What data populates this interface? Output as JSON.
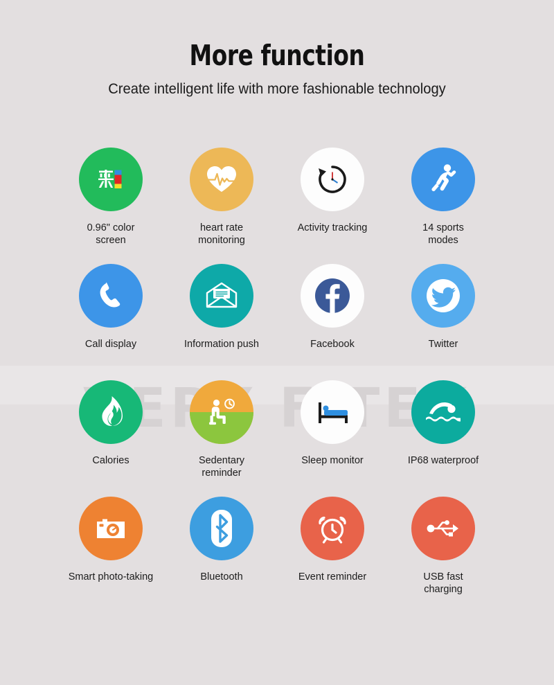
{
  "header": {
    "title": "More function",
    "subtitle": "Create intelligent life with more fashionable technology"
  },
  "watermark": {
    "text": "VERY FiTEK"
  },
  "colors": {
    "background": "#e3dfe0",
    "green": "#22bb5b",
    "gold": "#edb857",
    "white": "#fdfdfd",
    "blue": "#3d95e8",
    "teal_info": "#0ea9a8",
    "fb_blue": "#3b5998",
    "twitter_blue": "#55acee",
    "emerald": "#17b877",
    "orange_top": "#f0a93c",
    "green_bottom": "#8cc63e",
    "teal_water": "#0cab9e",
    "orange": "#ee8232",
    "bt_blue": "#3d9ee0",
    "red_orange": "#e8634a"
  },
  "features": [
    {
      "id": "color-screen",
      "label": "0.96\" color\nscreen",
      "icon": "color-screen-icon",
      "circle": "#22bb5b"
    },
    {
      "id": "heart-rate",
      "label": "heart rate\nmonitoring",
      "icon": "heart-rate-icon",
      "circle": "#edb857"
    },
    {
      "id": "activity-tracking",
      "label": "Activity tracking",
      "icon": "activity-clock-icon",
      "circle": "#fdfdfd"
    },
    {
      "id": "sports-modes",
      "label": "14 sports\nmodes",
      "icon": "running-person-icon",
      "circle": "#3d95e8"
    },
    {
      "id": "call-display",
      "label": "Call display",
      "icon": "phone-icon",
      "circle": "#3d95e8"
    },
    {
      "id": "information-push",
      "label": "Information push",
      "icon": "envelope-message-icon",
      "circle": "#0ea9a8"
    },
    {
      "id": "facebook",
      "label": "Facebook",
      "icon": "facebook-icon",
      "circle": "#fdfdfd"
    },
    {
      "id": "twitter",
      "label": "Twitter",
      "icon": "twitter-bird-icon",
      "circle": "#55acee"
    },
    {
      "id": "calories",
      "label": "Calories",
      "icon": "flame-icon",
      "circle": "#17b877"
    },
    {
      "id": "sedentary",
      "label": "Sedentary\nreminder",
      "icon": "sitting-person-clock-icon",
      "circle": "#f0a93c"
    },
    {
      "id": "sleep-monitor",
      "label": "Sleep monitor",
      "icon": "bed-icon",
      "circle": "#fdfdfd"
    },
    {
      "id": "ip68-waterproof",
      "label": "IP68 waterproof",
      "icon": "swimmer-icon",
      "circle": "#0cab9e"
    },
    {
      "id": "smart-photo",
      "label": "Smart photo-taking",
      "icon": "camera-icon",
      "circle": "#ee8232"
    },
    {
      "id": "bluetooth",
      "label": "Bluetooth",
      "icon": "bluetooth-icon",
      "circle": "#3d9ee0"
    },
    {
      "id": "event-reminder",
      "label": "Event reminder",
      "icon": "alarm-clock-icon",
      "circle": "#e8634a"
    },
    {
      "id": "usb-charging",
      "label": "USB fast\ncharging",
      "icon": "usb-icon",
      "circle": "#e8634a"
    }
  ]
}
